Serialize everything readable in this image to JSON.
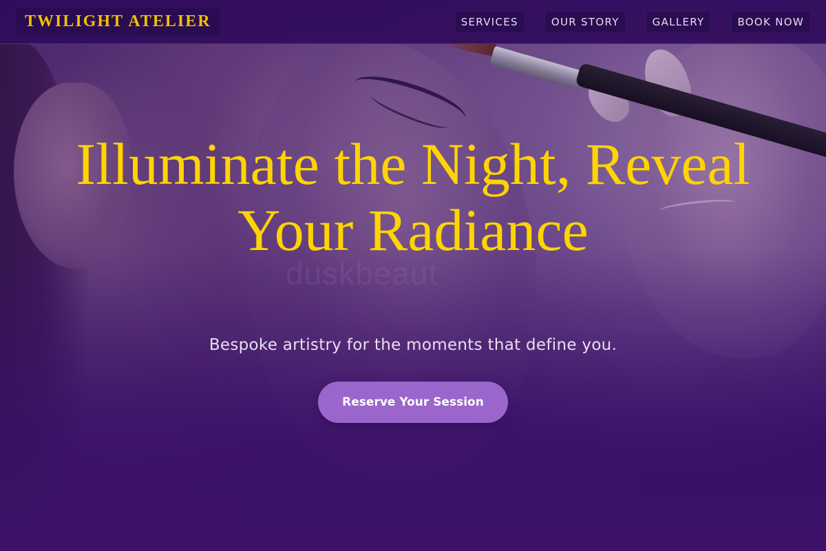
{
  "header": {
    "brand": "TWILIGHT ATELIER",
    "nav": [
      {
        "label": "SERVICES"
      },
      {
        "label": "OUR STORY"
      },
      {
        "label": "GALLERY"
      },
      {
        "label": "BOOK NOW"
      }
    ]
  },
  "hero": {
    "title": "Illuminate the Night, Reveal Your Radiance",
    "subtitle": "Bespoke artistry for the moments that define you.",
    "cta_label": "Reserve Your Session",
    "background_watermark": "duskbeaut"
  },
  "colors": {
    "accent_gold": "#ffd400",
    "brand_gold": "#f2c100",
    "header_bg": "#300c5c",
    "cta_purple": "#9b66cc",
    "page_purple": "#3a1466"
  }
}
